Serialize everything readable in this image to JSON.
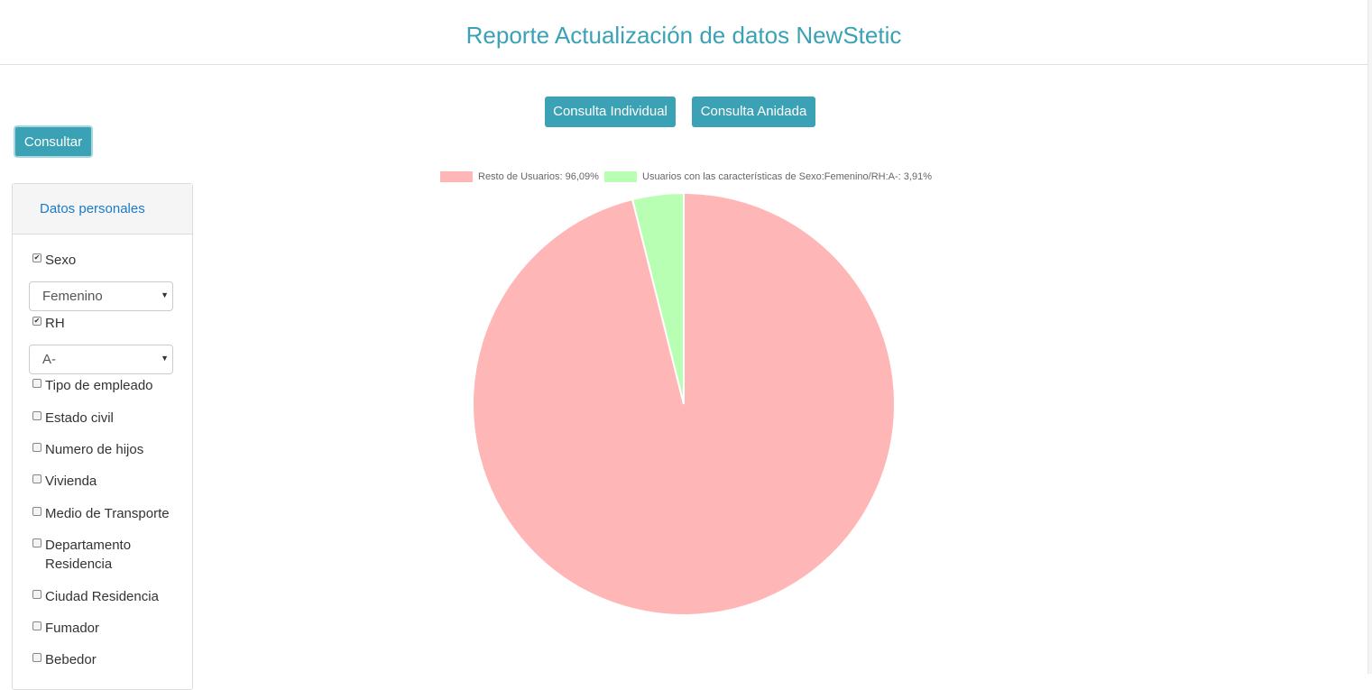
{
  "header": {
    "title": "Reporte Actualización de datos NewStetic"
  },
  "actions": {
    "individual_label": "Consulta Individual",
    "anidada_label": "Consulta Anidada",
    "consultar_label": "Consultar"
  },
  "panel": {
    "title": "Datos personales",
    "sexo": {
      "label": "Sexo",
      "checked": true,
      "select_value": "Femenino"
    },
    "rh": {
      "label": "RH",
      "checked": true,
      "select_value": "A-"
    },
    "options": [
      {
        "label": "Tipo de empleado",
        "checked": false
      },
      {
        "label": "Estado civil",
        "checked": false
      },
      {
        "label": "Numero de hijos",
        "checked": false
      },
      {
        "label": "Vivienda",
        "checked": false
      },
      {
        "label": "Medio de Transporte",
        "checked": false
      },
      {
        "label": "Departamento",
        "label_line2": "Residencia",
        "checked": false
      },
      {
        "label": "Ciudad Residencia",
        "checked": false
      },
      {
        "label": "Fumador",
        "checked": false
      },
      {
        "label": "Bebedor",
        "checked": false
      }
    ]
  },
  "chart_data": {
    "type": "pie",
    "title": "",
    "legend_position": "top",
    "slices": [
      {
        "label": "Resto de Usuarios: 96,09%",
        "value": 96.09,
        "color": "#ffb6b6"
      },
      {
        "label": "Usuarios con las características de Sexo:Femenino/RH:A-: 3,91%",
        "value": 3.91,
        "color": "#b9ffb3"
      }
    ]
  },
  "colors": {
    "accent": "#3aa2b4",
    "link": "#1a7ac8"
  }
}
